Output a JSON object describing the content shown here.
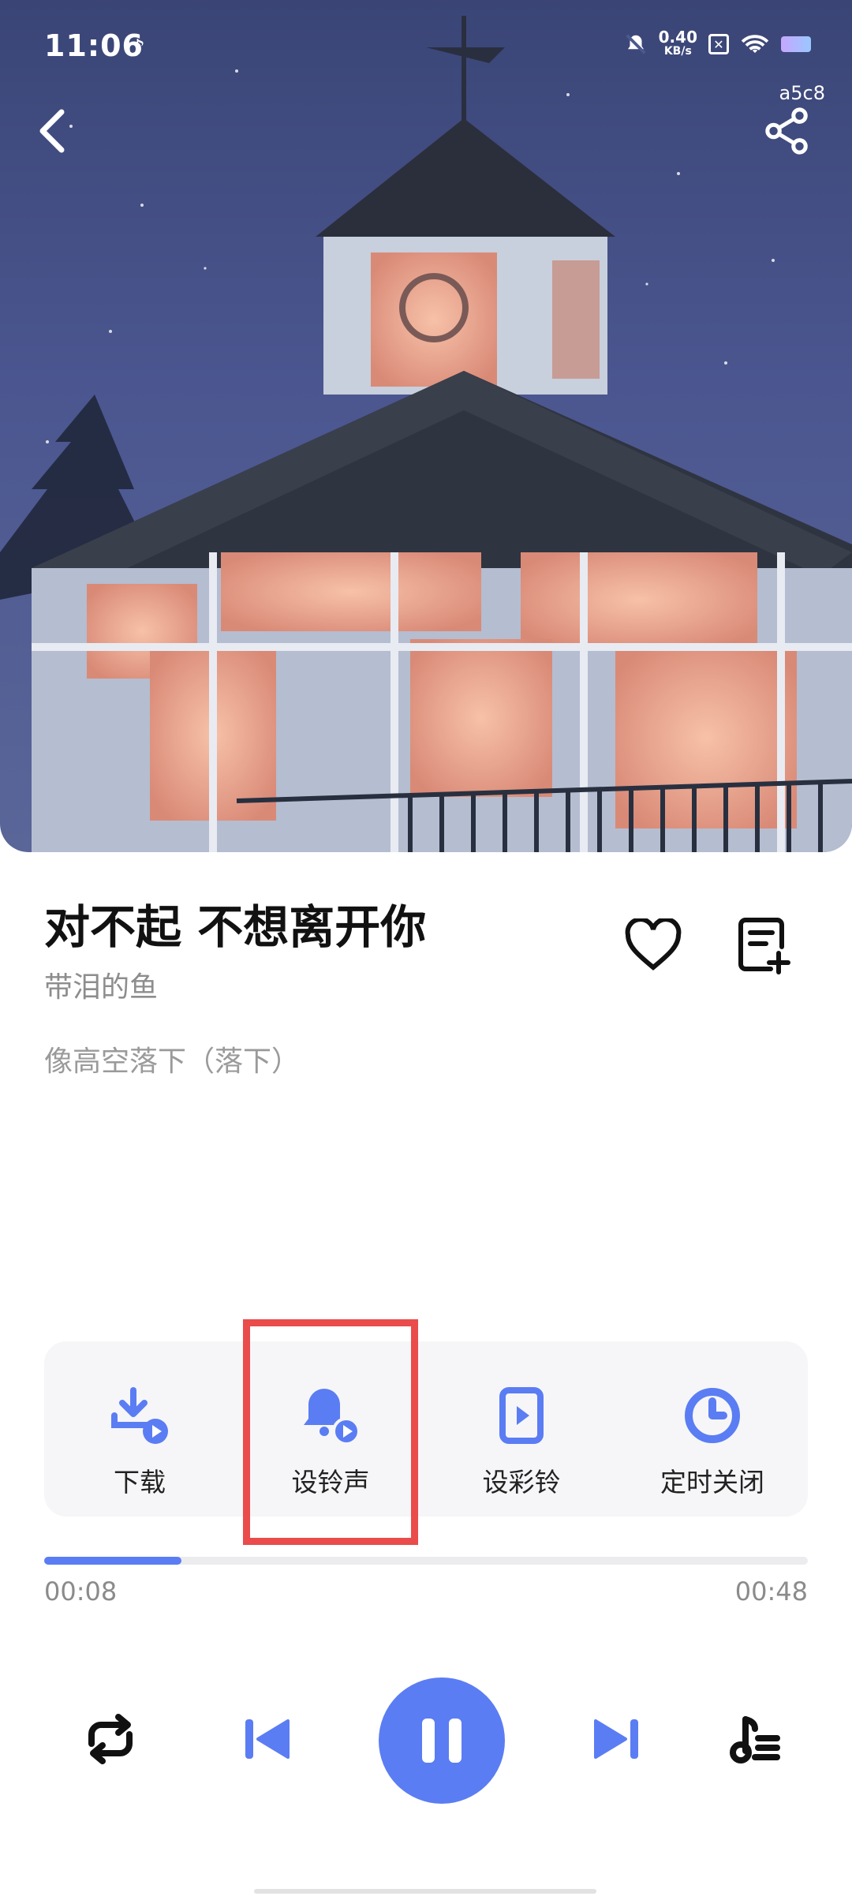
{
  "status_bar": {
    "time": "11:06",
    "net_speed_value": "0.40",
    "net_speed_unit": "KB/s"
  },
  "header": {
    "tag": "a5c8",
    "back_icon": "chevron-left-icon",
    "share_icon": "share-icon"
  },
  "song": {
    "title": "对不起 不想离开你",
    "artist": "带泪的鱼",
    "lyric_line": "像高空落下（落下）"
  },
  "actions": [
    {
      "label": "下载",
      "icon": "download-icon"
    },
    {
      "label": "设铃声",
      "icon": "bell-icon"
    },
    {
      "label": "设彩铃",
      "icon": "phone-play-icon"
    },
    {
      "label": "定时关闭",
      "icon": "clock-icon"
    }
  ],
  "progress": {
    "current": "00:08",
    "total": "00:48",
    "fraction": 0.18
  },
  "colors": {
    "accent": "#5b7df3",
    "highlight": "#ea4b4b"
  }
}
